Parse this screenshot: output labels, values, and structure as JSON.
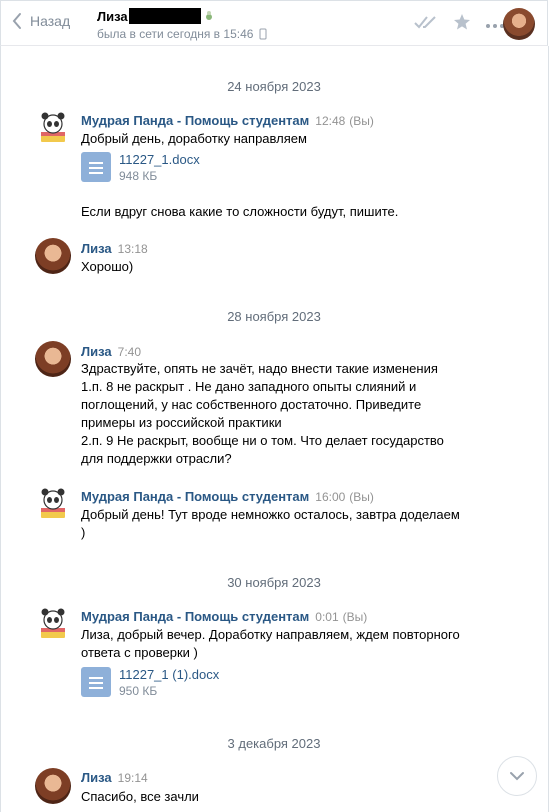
{
  "header": {
    "back_label": "Назад",
    "name": "Лиза",
    "status": "была в сети сегодня в 15:46"
  },
  "colors": {
    "link": "#2a5885",
    "muted": "#818c99",
    "doc_icon": "#8eb0d9"
  },
  "messages": [
    {
      "date": "24 ноября 2023"
    },
    {
      "author": "Мудрая Панда - Помощь студентам",
      "time": "12:48",
      "tag": "(Вы)",
      "text": "Добрый день, доработку направляем",
      "doc": {
        "name": "11227_1.docx",
        "size": "948 КБ"
      },
      "text2": "Если вдруг снова какие то сложности будут, пишите."
    },
    {
      "author": "Лиза",
      "time": "13:18",
      "text": "Хорошо)"
    },
    {
      "date": "28 ноября 2023"
    },
    {
      "author": "Лиза",
      "time": "7:40",
      "lines": [
        "Здраствуйте, опять не зачёт, надо внести такие изменения",
        "1.п. 8 не раскрыт . Не дано западного опыты слияний и",
        "поглощений, у нас собственного достаточно. Приведите",
        "примеры из российской практики",
        "2.п. 9 Не раскрыт, вообще ни о том. Что делает государство",
        "для поддержки отрасли?"
      ]
    },
    {
      "author": "Мудрая Панда - Помощь студентам",
      "time": "16:00",
      "tag": "(Вы)",
      "lines": [
        "Добрый день! Тут вроде немножко осталось, завтра доделаем",
        ")"
      ]
    },
    {
      "date": "30 ноября 2023"
    },
    {
      "author": "Мудрая Панда - Помощь студентам",
      "time": "0:01",
      "tag": "(Вы)",
      "lines": [
        "Лиза, добрый вечер. Доработку направляем, ждем повторного",
        "ответа с проверки )"
      ],
      "doc": {
        "name": "11227_1 (1).docx",
        "size": "950 КБ"
      }
    },
    {
      "date": "3 декабря 2023"
    },
    {
      "author": "Лиза",
      "time": "19:14",
      "text": "Спасибо, все зачли"
    }
  ]
}
